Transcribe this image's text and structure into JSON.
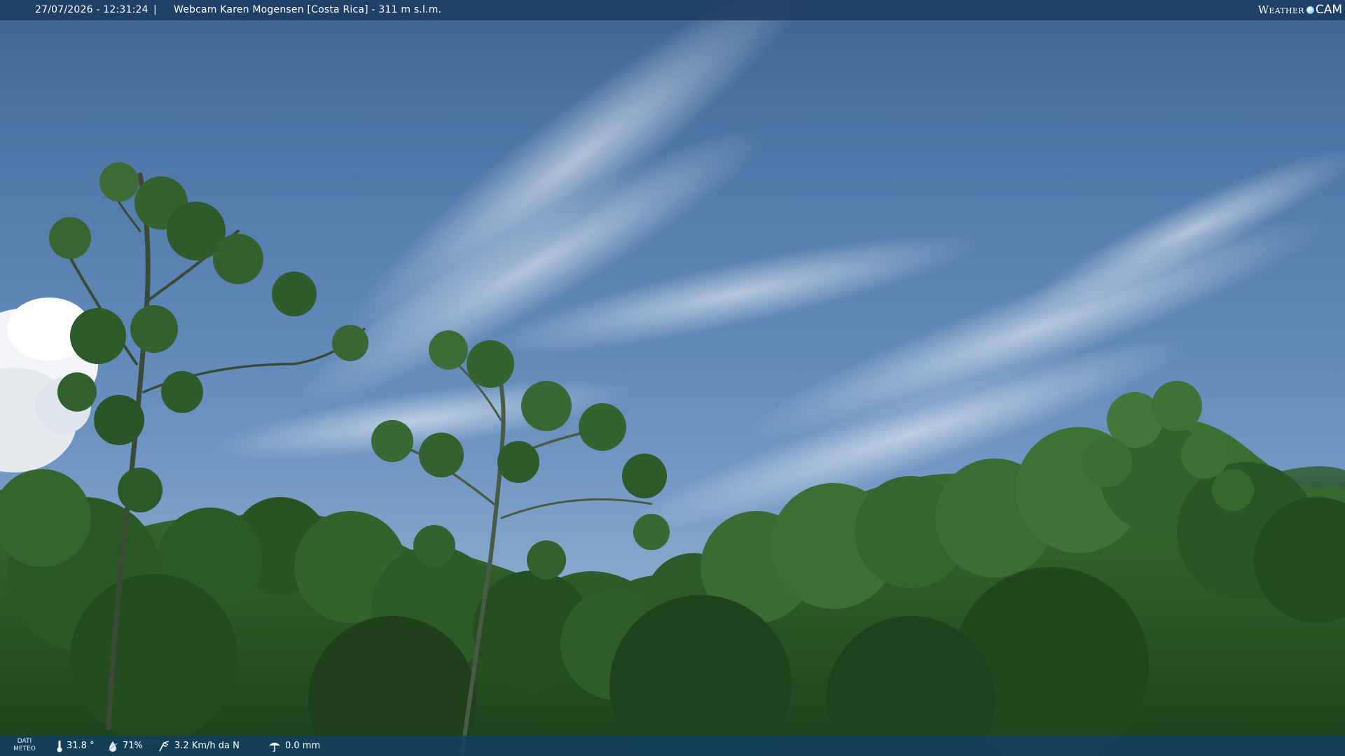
{
  "header": {
    "timestamp": "27/07/2026 - 12:31:24",
    "separator": "|",
    "title": "Webcam Karen Mogensen [Costa Rica]  - 311 m s.l.m.",
    "logo_left": "Weather",
    "logo_right": "CAM"
  },
  "weather_bar": {
    "label_line1": "DATI",
    "label_line2": "METEO",
    "temperature": "31.8 °",
    "temperature_icon": "thermometer-icon",
    "humidity": "71%",
    "humidity_icon": "humidity-drop-icon",
    "wind": "3.2 Km/h da N",
    "wind_icon": "wind-icon",
    "rain": "0.0 mm",
    "rain_icon": "rain-gauge-icon"
  },
  "colors": {
    "top_bar": "#1b385e",
    "bottom_bar": "#124064",
    "sky_top": "#3f6494",
    "sky_bottom": "#8fb0d4",
    "foliage": "#2f5e2a"
  }
}
